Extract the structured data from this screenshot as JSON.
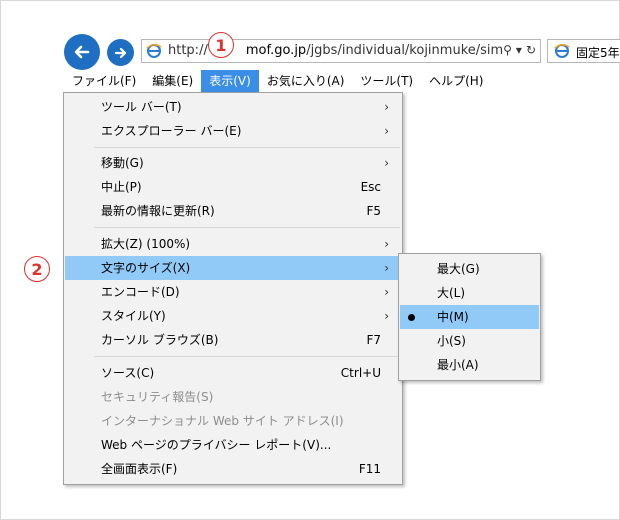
{
  "browser": {
    "address_prefix": "http://",
    "address_domain": "mof.go.jp",
    "address_path": "/jgbs/individual/kojinmuke/simu",
    "tab_title": "固定5年"
  },
  "menubar": [
    {
      "label": "ファイル(F)"
    },
    {
      "label": "編集(E)"
    },
    {
      "label": "表示(V)"
    },
    {
      "label": "お気に入り(A)"
    },
    {
      "label": "ツール(T)"
    },
    {
      "label": "ヘルプ(H)"
    }
  ],
  "view_menu": {
    "items": [
      {
        "label": "ツール バー(T)",
        "shortcut": "",
        "arrow": "›"
      },
      {
        "label": "エクスプローラー バー(E)",
        "shortcut": "",
        "arrow": "›"
      },
      {
        "label": "移動(G)",
        "shortcut": "",
        "arrow": "›"
      },
      {
        "label": "中止(P)",
        "shortcut": "Esc",
        "arrow": ""
      },
      {
        "label": "最新の情報に更新(R)",
        "shortcut": "F5",
        "arrow": ""
      },
      {
        "label": "拡大(Z) (100%)",
        "shortcut": "",
        "arrow": "›"
      },
      {
        "label": "文字のサイズ(X)",
        "shortcut": "",
        "arrow": "›"
      },
      {
        "label": "エンコード(D)",
        "shortcut": "",
        "arrow": "›"
      },
      {
        "label": "スタイル(Y)",
        "shortcut": "",
        "arrow": "›"
      },
      {
        "label": "カーソル ブラウズ(B)",
        "shortcut": "F7",
        "arrow": ""
      },
      {
        "label": "ソース(C)",
        "shortcut": "Ctrl+U",
        "arrow": ""
      },
      {
        "label": "セキュリティ報告(S)",
        "shortcut": "",
        "arrow": ""
      },
      {
        "label": "インターナショナル Web サイト アドレス(I)",
        "shortcut": "",
        "arrow": ""
      },
      {
        "label": "Web ページのプライバシー レポート(V)...",
        "shortcut": "",
        "arrow": ""
      },
      {
        "label": "全画面表示(F)",
        "shortcut": "F11",
        "arrow": ""
      }
    ]
  },
  "text_size_submenu": {
    "items": [
      {
        "label": "最大(G)"
      },
      {
        "label": "大(L)"
      },
      {
        "label": "中(M)"
      },
      {
        "label": "小(S)"
      },
      {
        "label": "最小(A)"
      }
    ],
    "selected": "中(M)"
  },
  "callouts": {
    "one": "1",
    "two": "2"
  },
  "colors": {
    "accent": "#1e6fc2",
    "menu_highlight": "#91c9f7",
    "active_menu": "#3a8ee6",
    "callout": "#e03030"
  }
}
